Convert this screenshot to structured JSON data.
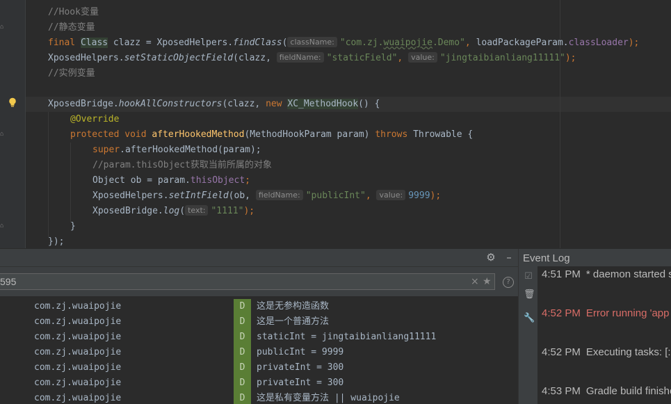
{
  "editor": {
    "lines": [
      {
        "comment": "//Hook变量"
      },
      {
        "comment": "//静态变量"
      },
      {
        "final": "final",
        "class_kw": "Class",
        "var": " clazz = XposedHelpers.",
        "method": "findClass",
        "hint1": "className:",
        "str1": "\"com.zj.",
        "str1_wavy": "wuaipojie",
        "str1_end": ".Demo\"",
        "arg2": "loadPackageParam.",
        "field": "classLoader",
        "end": ");"
      },
      {
        "obj": "XposedHelpers.",
        "method": "setStaticObjectField",
        "open": "(clazz, ",
        "hint1": "fieldName:",
        "str1": "\"staticField\"",
        "hint2": "value:",
        "str2": "\"jingtaibianliang11111\"",
        "end": ");"
      },
      {
        "comment": "//实例变量"
      },
      {
        "obj": "XposedBridge.",
        "method": "hookAllConstructors",
        "open": "(clazz, ",
        "new_kw": "new",
        "cls": "XC_MethodHook",
        "end": "() {"
      },
      {
        "annotation": "@Override"
      },
      {
        "mods": "protected void",
        "name": "afterHookedMethod",
        "params": "(MethodHookParam param)",
        "throws_kw": "throws",
        "exc": "Throwable {"
      },
      {
        "super_kw": "super",
        "rest": ".afterHookedMethod(param);"
      },
      {
        "comment": "//param.thisObject获取当前所属的对象"
      },
      {
        "decl": "Object ob = param.",
        "field": "thisObject",
        "end": ";"
      },
      {
        "obj": "XposedHelpers.",
        "method": "setIntField",
        "open": "(ob, ",
        "hint1": "fieldName:",
        "str1": "\"publicInt\"",
        "hint2": "value:",
        "num": "9999",
        "end": ");"
      },
      {
        "obj": "XposedBridge.",
        "method": "log",
        "open": "(",
        "hint1": "text:",
        "str1": "\"1111\"",
        "end": ");"
      },
      {
        "text": "}"
      },
      {
        "text": "});"
      }
    ]
  },
  "logcat": {
    "filter_value": "595",
    "rows": [
      {
        "package": "com.zj.wuaipojie",
        "level": "D",
        "message": "这是无参构造函数"
      },
      {
        "package": "com.zj.wuaipojie",
        "level": "D",
        "message": "这是一个普通方法"
      },
      {
        "package": "com.zj.wuaipojie",
        "level": "D",
        "message": "staticInt = jingtaibianliang11111"
      },
      {
        "package": "com.zj.wuaipojie",
        "level": "D",
        "message": "publicInt = 9999"
      },
      {
        "package": "com.zj.wuaipojie",
        "level": "D",
        "message": "privateInt = 300"
      },
      {
        "package": "com.zj.wuaipojie",
        "level": "D",
        "message": "privateInt = 300"
      },
      {
        "package": "com.zj.wuaipojie",
        "level": "D",
        "message": "这是私有变量方法 || wuaipojie"
      }
    ]
  },
  "event_log": {
    "title": "Event Log",
    "entries": [
      {
        "time": "4:51 PM",
        "message": "* daemon started s",
        "type": "info"
      },
      {
        "time": "4:52 PM",
        "message": "Error running 'app",
        "type": "error"
      },
      {
        "time": "4:52 PM",
        "message": "Executing tasks: [:a",
        "type": "info"
      },
      {
        "time": "4:53 PM",
        "message": "Gradle build finishe",
        "type": "info"
      }
    ]
  },
  "colors": {
    "editor_bg": "#2b2b2b",
    "keyword": "#cc7832",
    "string": "#6a8759",
    "comment": "#808080",
    "number": "#6897bb",
    "field": "#9876aa",
    "annotation": "#bbb529",
    "method_decl": "#ffc66d",
    "log_level_debug": "#5a7e35",
    "event_error": "#d96d67"
  },
  "icons": [
    "lightbulb-icon",
    "settings-gear-icon",
    "minimize-icon",
    "clear-filter-icon",
    "favorite-star-icon",
    "help-icon",
    "mark-read-icon",
    "trash-icon",
    "wrench-icon"
  ]
}
